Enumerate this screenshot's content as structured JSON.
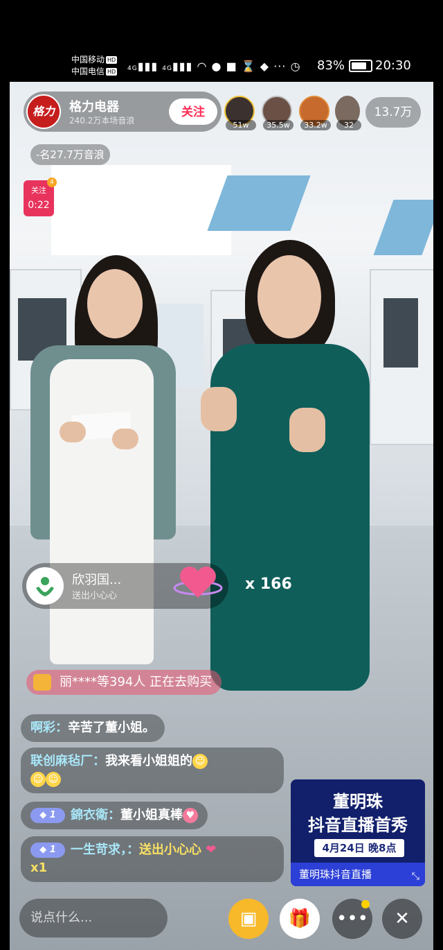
{
  "status_bar": {
    "carrier1": "中国移动",
    "carrier2": "中国电信",
    "hd": "HD",
    "signal": "4G",
    "battery": "83%",
    "time": "20:30"
  },
  "anchor": {
    "logo_text": "格力",
    "name": "格力电器",
    "sub": "240.2万本场音浪",
    "follow": "关注"
  },
  "top_viewers": [
    {
      "badge": "51w"
    },
    {
      "badge": "35.5w"
    },
    {
      "badge": "33.2w"
    },
    {
      "badge": "32"
    }
  ],
  "viewer_count": "13.7万",
  "rank": "-名27.7万音浪",
  "timer": {
    "label": "关注",
    "time": "0:22",
    "dot": "4"
  },
  "gift_notice": {
    "name": "欣羽国...",
    "desc": "送出小心心",
    "count": "x 166"
  },
  "buy_notice": "丽****等394人 正在去购买",
  "comments": [
    {
      "user": "啊彩：",
      "text": "辛苦了董小姐。"
    },
    {
      "user": "联创麻毡厂：",
      "text": "我来看小姐姐的"
    },
    {
      "level": "1",
      "user": "錦衣衛：",
      "text": "董小姐真棒"
    },
    {
      "level": "1",
      "user": "一生苛求，：",
      "text": "送出小心心",
      "suffix": "x1"
    }
  ],
  "promo": {
    "title1": "董明珠",
    "title2": "抖音直播首秀",
    "date": "4月24日 晚8点",
    "footer": "董明珠抖音直播"
  },
  "input_placeholder": "说点什么...",
  "colors": {
    "accent": "#fe2c55",
    "promo_bg": "#12206b"
  }
}
